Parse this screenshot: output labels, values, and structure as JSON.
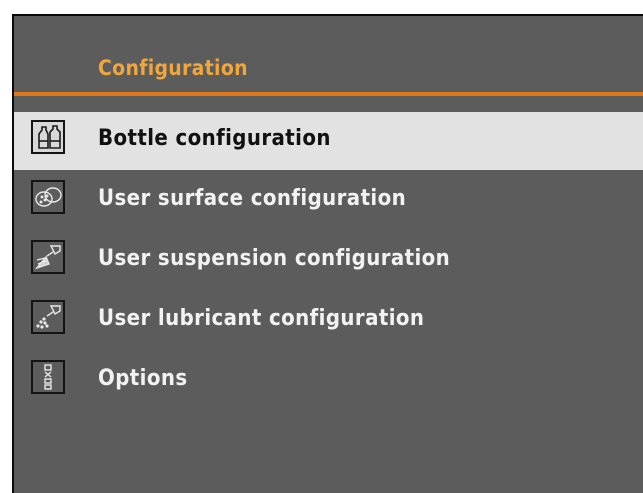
{
  "header": {
    "title": "Configuration"
  },
  "menu": {
    "items": [
      {
        "label": "Bottle configuration",
        "icon": "bottle-icon",
        "selected": true
      },
      {
        "label": "User surface configuration",
        "icon": "surface-icon",
        "selected": false
      },
      {
        "label": "User suspension configuration",
        "icon": "spray-suspension-icon",
        "selected": false
      },
      {
        "label": "User lubricant configuration",
        "icon": "spray-lubricant-icon",
        "selected": false
      },
      {
        "label": "Options",
        "icon": "options-icon",
        "selected": false
      }
    ]
  },
  "colors": {
    "background": "#5c5c5c",
    "title": "#f0a63a",
    "rule": "#e0771a",
    "selected_row": "#e2e2e2",
    "text": "#f2f2f2"
  }
}
